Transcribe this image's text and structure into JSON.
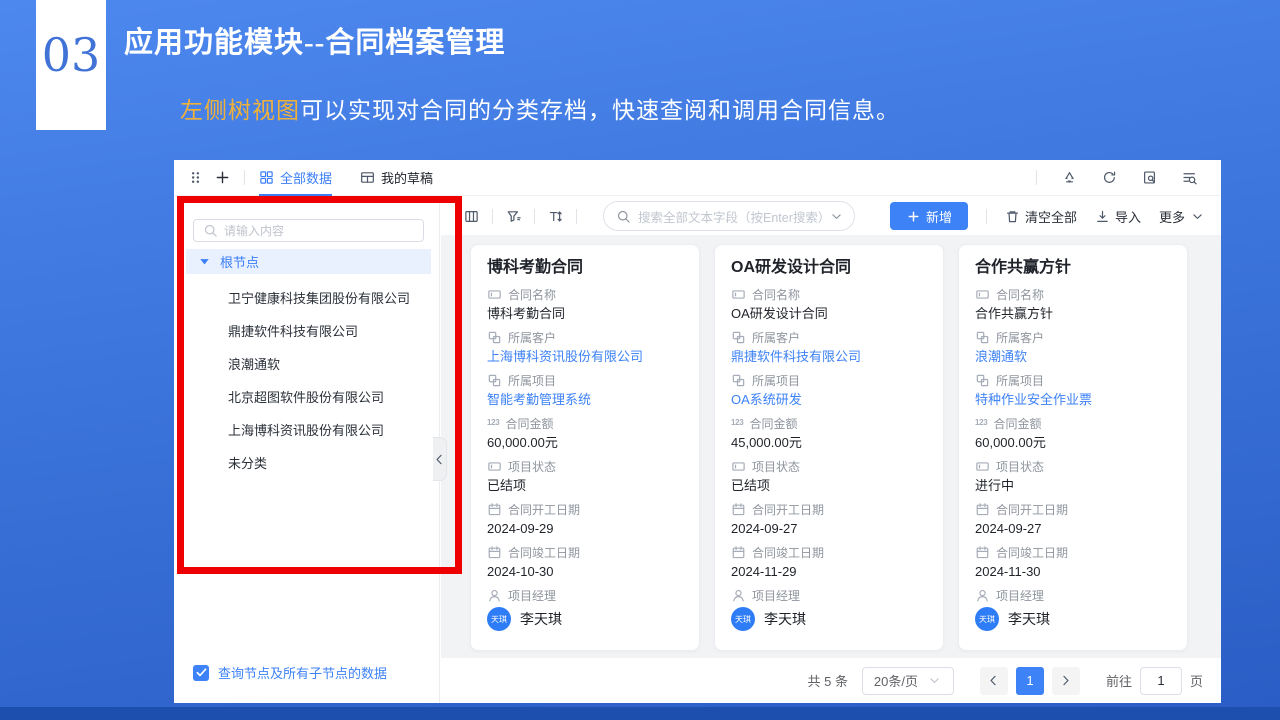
{
  "slide": {
    "badge_number": "03",
    "title": "应用功能模块--合同档案管理",
    "subtitle": {
      "highlight": "左侧树视图",
      "rest": "可以实现对合同的分类存档，快速查阅和调用合同信息。"
    }
  },
  "app": {
    "tabs": [
      {
        "label": "全部数据"
      },
      {
        "label": "我的草稿"
      }
    ],
    "filter_bar": {
      "search_placeholder": "搜索全部文本字段（按Enter搜索）",
      "add_label": "新增",
      "clear_label": "清空全部",
      "import_label": "导入",
      "more_label": "更多"
    },
    "tree": {
      "search_placeholder": "请输入内容",
      "root_label": "根节点",
      "items": [
        "卫宁健康科技集团股份有限公司",
        "鼎捷软件科技有限公司",
        "浪潮通软",
        "北京超图软件股份有限公司",
        "上海博科资讯股份有限公司",
        "未分类"
      ],
      "footer_checkbox_label": "查询节点及所有子节点的数据"
    },
    "field_labels": [
      "合同名称",
      "所属客户",
      "所属项目",
      "合同金额",
      "项目状态",
      "合同开工日期",
      "合同竣工日期",
      "项目经理"
    ],
    "cards": [
      {
        "title": "博科考勤合同",
        "name": "博科考勤合同",
        "customer": "上海博科资讯股份有限公司",
        "project": "智能考勤管理系统",
        "amount": "60,000.00元",
        "status": "已结项",
        "start_date": "2024-09-29",
        "end_date": "2024-10-30",
        "manager": "李天琪",
        "avatar_text": "天琪"
      },
      {
        "title": "OA研发设计合同",
        "name": "OA研发设计合同",
        "customer": "鼎捷软件科技有限公司",
        "project": "OA系统研发",
        "amount": "45,000.00元",
        "status": "已结项",
        "start_date": "2024-09-27",
        "end_date": "2024-11-29",
        "manager": "李天琪",
        "avatar_text": "天琪"
      },
      {
        "title": "合作共赢方针",
        "name": "合作共赢方针",
        "customer": "浪潮通软",
        "project": "特种作业安全作业票",
        "amount": "60,000.00元",
        "status": "进行中",
        "start_date": "2024-09-27",
        "end_date": "2024-11-30",
        "manager": "李天琪",
        "avatar_text": "天琪"
      }
    ],
    "pagination": {
      "total": "共 5 条",
      "page_size": "20条/页",
      "current_page": "1",
      "goto_prefix": "前往",
      "goto_value": "1",
      "goto_suffix": "页"
    },
    "colors": {
      "accent": "#3d82f6",
      "annotation_red": "#ee0000",
      "subtitle_highlight": "#f0b13a"
    }
  }
}
